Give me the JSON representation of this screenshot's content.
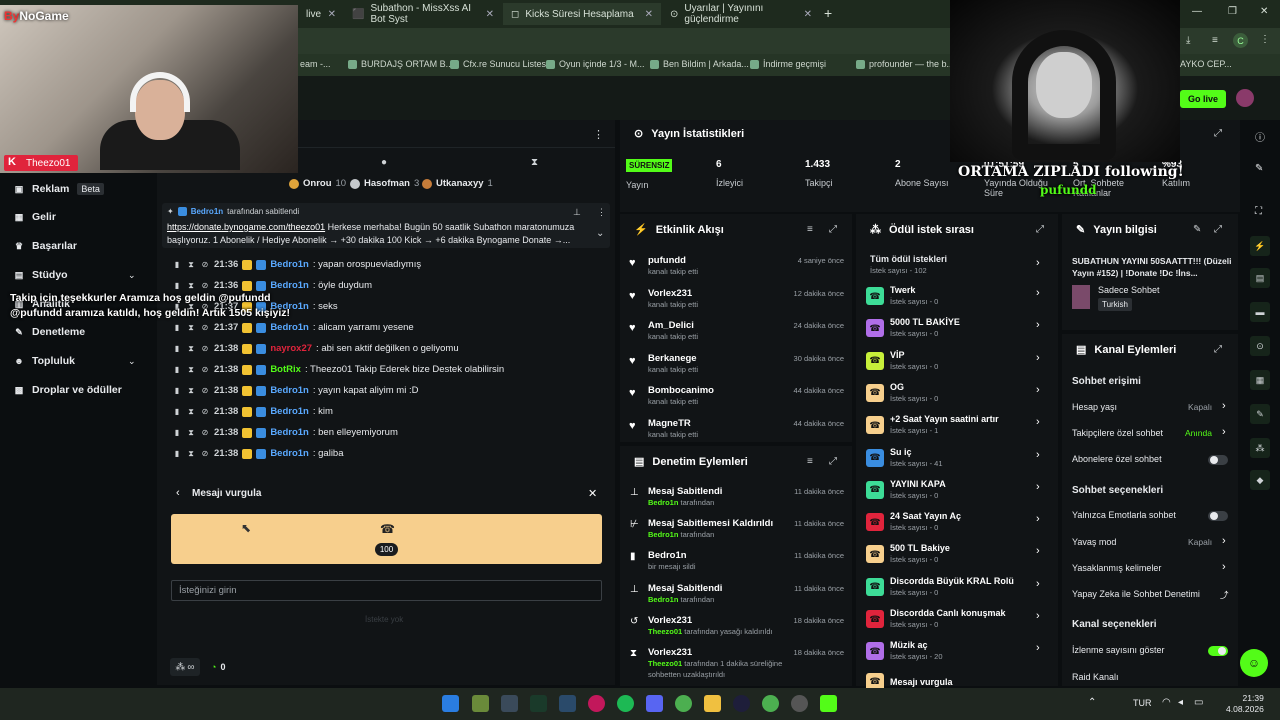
{
  "browser": {
    "tabs": [
      {
        "label": "live"
      },
      {
        "label": "Subathon - MissXss AI Bot Syst"
      },
      {
        "label": "Kicks Süresi Hesaplama"
      },
      {
        "label": "Uyarılar | Yayınını güçlendirme"
      }
    ],
    "new_tab": "+",
    "bookmarks": [
      "eam -...",
      "BURDAJŞ ORTAM B...",
      "Cfx.re Sunucu Listesi",
      "Oyun içinde 1/3 - M...",
      "Ben Bildim | Arkada...",
      "İndirme geçmişi",
      "profounder — the b...",
      "AYKO CEP..."
    ],
    "profile": "C"
  },
  "overlay": {
    "logo_by": "By",
    "logo_rest": "NoGame",
    "streamer": "Theezo01",
    "big_text": "ORTAMA ZIPLADI following!",
    "big_user": "pufundd",
    "follow_msg": "Takip için teşekkurler Aramıza hoş geldin @pufundd",
    "join_msg": "@pufundd aramıza katıldı, hoş geldin! Artık 1505 kişiyiz!"
  },
  "header": {
    "golive": "Go live"
  },
  "sidebar": {
    "items": [
      {
        "label": "Reklam",
        "badge": "Beta"
      },
      {
        "label": "Gelir"
      },
      {
        "label": "Başarılar"
      },
      {
        "label": "Stüdyo"
      },
      {
        "label": "Analitik"
      },
      {
        "label": "Denetleme"
      },
      {
        "label": "Topluluk"
      },
      {
        "label": "Droplar ve ödüller"
      }
    ]
  },
  "chat": {
    "top_gifters": [
      {
        "name": "Onrou",
        "count": "10"
      },
      {
        "name": "Hasofman",
        "count": "3"
      },
      {
        "name": "Utkanaxyy",
        "count": "1"
      }
    ],
    "pinned_by": "Bedro1n",
    "pinned_suffix": "tarafından sabitlendi",
    "pinned_link": "https://donate.bynogame.com/theezo01",
    "pinned_text1": " Herkese merhaba! Bugün 50 saatlik Subathon maratonumuza",
    "pinned_text2": "başlıyoruz. 1 Abonelik / Hediye Abonelik → +30 dakika 100 Kick → +6 dakika Bynogame Donate →...",
    "messages": [
      {
        "time": "21:36",
        "user": "Bedro1n",
        "text": ": yapan orospueviadıymış",
        "color": "#5aa9ff"
      },
      {
        "time": "21:36",
        "user": "Bedro1n",
        "text": ": öyle duydum",
        "color": "#5aa9ff"
      },
      {
        "time": "21:37",
        "user": "Bedro1n",
        "text": ": seks",
        "color": "#5aa9ff"
      },
      {
        "time": "21:37",
        "user": "Bedro1n",
        "text": ": alicam yarramı yesene",
        "color": "#5aa9ff"
      },
      {
        "time": "21:38",
        "user": "nayrox27",
        "text": ": abi sen aktif değilken o geliyomu",
        "color": "#e0243c"
      },
      {
        "time": "21:38",
        "user": "BotRix",
        "text": ": Theezo01 Takip Ederek bize Destek olabilirsin",
        "color": "#53fc18"
      },
      {
        "time": "21:38",
        "user": "Bedro1n",
        "text": ": yayın kapat aliyim mi :D",
        "color": "#5aa9ff"
      },
      {
        "time": "21:38",
        "user": "Bedro1n",
        "text": ": kim",
        "color": "#5aa9ff"
      },
      {
        "time": "21:38",
        "user": "Bedro1n",
        "text": ": ben elleyemiyorum",
        "color": "#5aa9ff"
      },
      {
        "time": "21:38",
        "user": "Bedro1n",
        "text": ": galiba",
        "color": "#5aa9ff"
      }
    ],
    "highlight_title": "Mesajı vurgula",
    "highlight_amount": "100",
    "input_placeholder": "İsteğinizi girin",
    "send_label": "İstekte yok",
    "balance": "0",
    "infinity": "∞"
  },
  "stats": {
    "title": "Yayın İstatistikleri",
    "items": [
      {
        "value": "SÜRENSIZ",
        "label": "Yayın"
      },
      {
        "value": "6",
        "label": "İzleyici"
      },
      {
        "value": "1.433",
        "label": "Takipçi"
      },
      {
        "value": "2",
        "label": "Abone Sayısı"
      },
      {
        "value": "01:51:59",
        "label": "Yayında Olduğu Süre"
      },
      {
        "value": "5",
        "label": "Ort. Sohbete Katılanlar"
      },
      {
        "value": "%93",
        "label": "Katılım"
      }
    ]
  },
  "activity": {
    "title": "Etkinlik Akışı",
    "items": [
      {
        "name": "pufundd",
        "sub": "kanalı takip etti",
        "time": "4 saniye önce"
      },
      {
        "name": "Vorlex231",
        "sub": "kanalı takip etti",
        "time": "12 dakika önce"
      },
      {
        "name": "Am_Delici",
        "sub": "kanalı takip etti",
        "time": "24 dakika önce"
      },
      {
        "name": "Berkanege",
        "sub": "kanalı takip etti",
        "time": "30 dakika önce"
      },
      {
        "name": "Bombocanimo",
        "sub": "kanalı takip etti",
        "time": "44 dakika önce"
      },
      {
        "name": "MagneTR",
        "sub": "kanalı takip etti",
        "time": "44 dakika önce"
      }
    ]
  },
  "moderation": {
    "title": "Denetim Eylemleri",
    "items": [
      {
        "name": "Mesaj Sabitlendi",
        "by": "Bedro1n",
        "sub": " tarafından",
        "time": "11 dakika önce"
      },
      {
        "name": "Mesaj Sabitlemesi Kaldırıldı",
        "by": "Bedro1n",
        "sub": " tarafından",
        "time": "11 dakika önce"
      },
      {
        "name": "Bedro1n",
        "by": "",
        "sub": "bir mesajı sildi",
        "time": "11 dakika önce"
      },
      {
        "name": "Mesaj Sabitlendi",
        "by": "Bedro1n",
        "sub": " tarafından",
        "time": "11 dakika önce"
      },
      {
        "name": "Vorlex231",
        "by": "Theezo01",
        "sub": " tarafından yasağı kaldırıldı",
        "time": "18 dakika önce"
      },
      {
        "name": "Vorlex231",
        "by": "Theezo01",
        "sub": " tarafından 1 dakika süreliğine sohbetten uzaklaştırıldı",
        "time": "18 dakika önce"
      }
    ]
  },
  "rewards": {
    "title": "Ödül istek sırası",
    "all": "Tüm ödül istekleri",
    "all_count": "İstek sayısı - 102",
    "items": [
      {
        "name": "Twerk",
        "count": "İstek sayısı - 0",
        "color": "#3ddc97"
      },
      {
        "name": "5000 TL BAKİYE",
        "count": "İstek sayısı - 0",
        "color": "#b06ee8"
      },
      {
        "name": "VİP",
        "count": "İstek sayısı - 0",
        "color": "#c7f03a"
      },
      {
        "name": "OG",
        "count": "İstek sayısı - 0",
        "color": "#f7cf8d"
      },
      {
        "name": "+2 Saat Yayın saatini artır",
        "count": "İstek sayısı - 1",
        "color": "#f7cf8d"
      },
      {
        "name": "Su iç",
        "count": "İstek sayısı - 41",
        "color": "#3a8de0"
      },
      {
        "name": "YAYINI KAPA",
        "count": "İstek sayısı - 0",
        "color": "#3ddc97"
      },
      {
        "name": "24 Saat Yayın Aç",
        "count": "İstek sayısı - 0",
        "color": "#e0243c"
      },
      {
        "name": "500 TL Bakiye",
        "count": "İstek sayısı - 0",
        "color": "#f7cf8d"
      },
      {
        "name": "Discordda Büyük KRAL Rolü",
        "count": "İstek sayısı - 0",
        "color": "#3ddc97"
      },
      {
        "name": "Discordda Canlı konuşmak",
        "count": "İstek sayısı - 0",
        "color": "#e0243c"
      },
      {
        "name": "Müzik aç",
        "count": "İstek sayısı - 20",
        "color": "#b06ee8"
      },
      {
        "name": "Mesajı vurgula",
        "count": "",
        "color": "#f7cf8d"
      }
    ]
  },
  "info": {
    "title": "Yayın bilgisi",
    "stream_title": "SUBATHUN YAYINI 50SAATTT!!! (Düzeli Yayın #152) | !Donate !Dc !İns...",
    "category": "Sadece Sohbet",
    "language": "Turkish"
  },
  "channel": {
    "title": "Kanal Eylemleri",
    "chat_access": "Sohbet erişimi",
    "account_age": "Hesap yaşı",
    "account_age_val": "Kapalı",
    "followers_only": "Takipçilere özel sohbet",
    "followers_only_val": "Anında",
    "subs_only": "Abonelere özel sohbet",
    "chat_options": "Sohbet seçenekleri",
    "emotes_only": "Yalnızca Emotlarla sohbet",
    "slow_mode": "Yavaş mod",
    "slow_mode_val": "Kapalı",
    "banned_words": "Yasaklanmış kelimeler",
    "ai_mod": "Yapay Zeka ile Sohbet Denetimi",
    "channel_options": "Kanal seçenekleri",
    "viewer_count": "İzlenme sayısını göster",
    "raid": "Raid Kanalı"
  },
  "taskbar": {
    "lang": "TUR",
    "time": "21:39",
    "date": "4.08.2026"
  }
}
